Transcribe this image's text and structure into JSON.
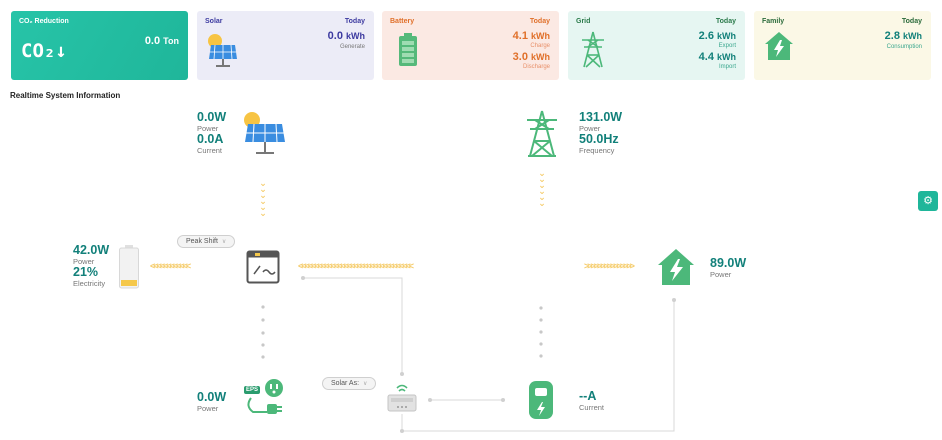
{
  "cards": {
    "co2": {
      "title": "CO₂ Reduction",
      "value": "0.0",
      "unit": "Ton",
      "symbol": "CO₂↓"
    },
    "solar": {
      "title": "Solar",
      "today": "Today",
      "value": "0.0",
      "unit": "kWh",
      "sub": "Generate"
    },
    "battery": {
      "title": "Battery",
      "today": "Today",
      "charge_value": "4.1",
      "charge_unit": "kWh",
      "charge_sub": "Charge",
      "discharge_value": "3.0",
      "discharge_unit": "kWh",
      "discharge_sub": "Discharge"
    },
    "grid": {
      "title": "Grid",
      "today": "Today",
      "export_value": "2.6",
      "export_unit": "kWh",
      "export_sub": "Export",
      "import_value": "4.4",
      "import_unit": "kWh",
      "import_sub": "Import"
    },
    "family": {
      "title": "Family",
      "today": "Today",
      "value": "2.8",
      "unit": "kWh",
      "sub": "Consumption"
    }
  },
  "section_title": "Realtime System Information",
  "solar": {
    "power": "0.0W",
    "power_label": "Power",
    "current": "0.0A",
    "current_label": "Current"
  },
  "grid": {
    "power": "131.0W",
    "power_label": "Power",
    "frequency": "50.0Hz",
    "frequency_label": "Frequency"
  },
  "battery": {
    "power": "42.0W",
    "power_label": "Power",
    "soc": "21%",
    "soc_label": "Electricity",
    "soc_fraction": 0.21
  },
  "home": {
    "power": "89.0W",
    "power_label": "Power"
  },
  "eps": {
    "power": "0.0W",
    "power_label": "Power",
    "badge": "EPS"
  },
  "charger": {
    "current": "--A",
    "current_label": "Current"
  },
  "mode_select": {
    "value": "Peak Shift"
  },
  "solar_assist_select": {
    "value": "Solar As:"
  },
  "colors": {
    "teal": "#12807a",
    "green": "#4cb87a",
    "accent": "#1fb69a",
    "arrow": "#f5cc6b",
    "orange": "#e0702a",
    "purple": "#3c3aa0"
  }
}
